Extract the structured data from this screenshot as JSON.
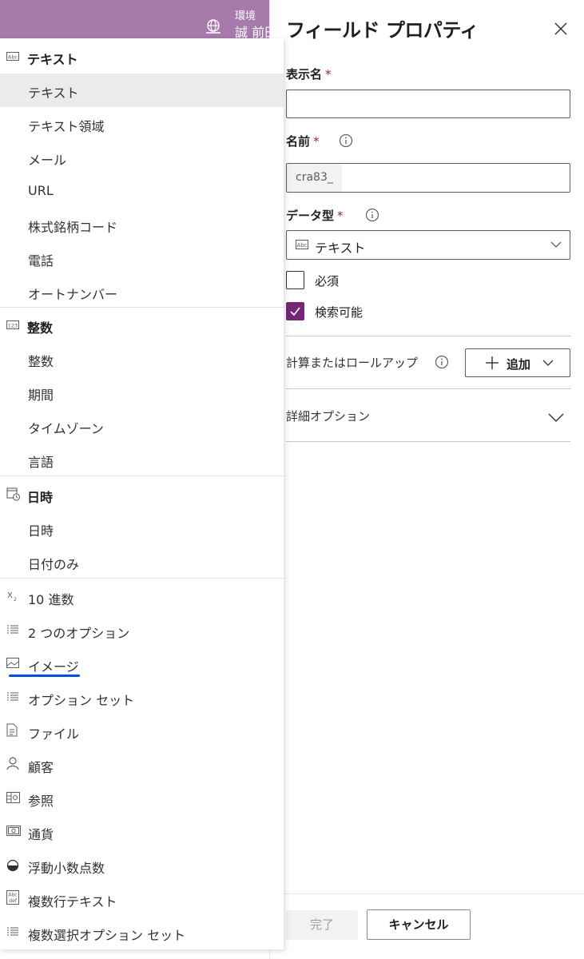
{
  "banner": {
    "env_label": "環境",
    "env_name": "誠 前田",
    "color": "#a67aab"
  },
  "panel": {
    "title": "フィールド プロパティ",
    "display_name": {
      "label": "表示名",
      "required": "*",
      "value": ""
    },
    "name": {
      "label": "名前",
      "required": "*",
      "prefix": "cra83_",
      "value": ""
    },
    "data_type": {
      "label": "データ型",
      "required": "*",
      "value": "テキスト",
      "icon": "abc-icon"
    },
    "required_checkbox": {
      "label": "必須",
      "checked": false
    },
    "searchable_checkbox": {
      "label": "検索可能",
      "checked": true
    },
    "calc_label": "計算またはロールアップ",
    "add_button": "追加",
    "advanced_options": "詳細オプション",
    "done_button": "完了",
    "cancel_button": "キャンセル"
  },
  "dropdown": {
    "groups": [
      {
        "header": "テキスト",
        "icon": "abc-icon",
        "items": [
          "テキスト",
          "テキスト領域",
          "メール",
          "URL",
          "株式銘柄コード",
          "電話",
          "オートナンバー"
        ],
        "selected": "テキスト"
      },
      {
        "header": "整数",
        "icon": "number-123-icon",
        "items": [
          "整数",
          "期間",
          "タイムゾーン",
          "言語"
        ]
      },
      {
        "header": "日時",
        "icon": "calendar-clock-icon",
        "items": [
          "日時",
          "日付のみ"
        ]
      }
    ],
    "items": [
      {
        "label": "10 進数",
        "icon": "subscript-x-icon"
      },
      {
        "label": "2 つのオプション",
        "icon": "list-icon"
      },
      {
        "label": "イメージ",
        "icon": "image-icon"
      },
      {
        "label": "オプション セット",
        "icon": "list-icon"
      },
      {
        "label": "ファイル",
        "icon": "document-icon"
      },
      {
        "label": "顧客",
        "icon": "person-icon"
      },
      {
        "label": "参照",
        "icon": "lookup-grid-icon"
      },
      {
        "label": "通貨",
        "icon": "currency-icon"
      },
      {
        "label": "浮動小数点数",
        "icon": "half-circle-icon"
      },
      {
        "label": "複数行テキスト",
        "icon": "abc-def-icon"
      },
      {
        "label": "複数選択オプション セット",
        "icon": "list-icon"
      }
    ]
  },
  "colors": {
    "accent": "#742774",
    "required": "#a4262c",
    "underline": "#0050d8"
  }
}
